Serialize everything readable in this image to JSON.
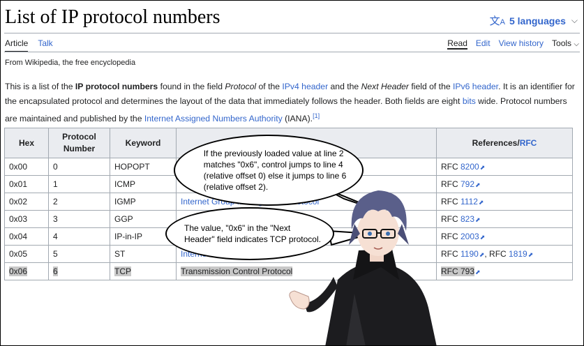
{
  "page": {
    "title": "List of IP protocol numbers",
    "languages": "5 languages",
    "tabs_left": [
      "Article",
      "Talk"
    ],
    "tabs_right": [
      "Read",
      "Edit",
      "View history",
      "Tools"
    ],
    "from": "From Wikipedia, the free encyclopedia"
  },
  "intro": {
    "p1": "This is a list of the ",
    "bold": "IP protocol numbers",
    "p2": " found in the field ",
    "it1": "Protocol",
    "p3": " of the ",
    "link1": "IPv4 header",
    "p4": " and the ",
    "it2": "Next Header",
    "p5": " field of the ",
    "link2": "IPv6 header",
    "p6": ". It is an identifier for the encapsulated protocol and determines the layout of the data that immediately follows the header. Both fields are eight ",
    "link3": "bits",
    "p7": " wide. Protocol numbers are maintained and published by the ",
    "link4": "Internet Assigned Numbers Authority",
    "p8": " (IANA).",
    "ref": "[1]"
  },
  "table": {
    "headers": {
      "hex": "Hex",
      "num": "Protocol Number",
      "kw": "Keyword",
      "refs": "References/",
      "refs_link": "RFC"
    },
    "rows": [
      {
        "hex": "0x00",
        "num": "0",
        "kw": "HOPOPT",
        "proto": "",
        "rfc_prefix": "RFC ",
        "rfc": "8200",
        "rfc2": ""
      },
      {
        "hex": "0x01",
        "num": "1",
        "kw": "ICMP",
        "proto": "",
        "rfc_prefix": "RFC ",
        "rfc": "792",
        "rfc2": ""
      },
      {
        "hex": "0x02",
        "num": "2",
        "kw": "IGMP",
        "proto": "Internet Group Management Protocol",
        "rfc_prefix": "RFC ",
        "rfc": "1112",
        "rfc2": ""
      },
      {
        "hex": "0x03",
        "num": "3",
        "kw": "GGP",
        "proto": "",
        "rfc_prefix": "RFC ",
        "rfc": "823",
        "rfc2": ""
      },
      {
        "hex": "0x04",
        "num": "4",
        "kw": "IP-in-IP",
        "proto": "",
        "rfc_prefix": "RFC ",
        "rfc": "2003",
        "rfc2": ""
      },
      {
        "hex": "0x05",
        "num": "5",
        "kw": "ST",
        "proto": "Internet Stream Protocol",
        "rfc_prefix": "RFC ",
        "rfc": "1190",
        "rfc2": "1819"
      },
      {
        "hex": "0x06",
        "num": "6",
        "kw": "TCP",
        "proto": "Transmission Control Protocol",
        "rfc_prefix": "RFC ",
        "rfc": "793",
        "rfc2": ""
      }
    ]
  },
  "bubbles": {
    "top": [
      "If the previously loaded value at line 2",
      "matches \"0x6\", control jumps to line 4",
      "(relative offset 0) else it jumps to line 6",
      "(relative offset 2)."
    ],
    "bottom": [
      "The value, \"0x6\" in the \"Next",
      "Header\" field indicates TCP protocol."
    ]
  },
  "colors": {
    "link": "#3366cc",
    "header_bg": "#eaecf0",
    "highlight": "#c8c8c8",
    "character_hair": "#5a5f8a"
  }
}
